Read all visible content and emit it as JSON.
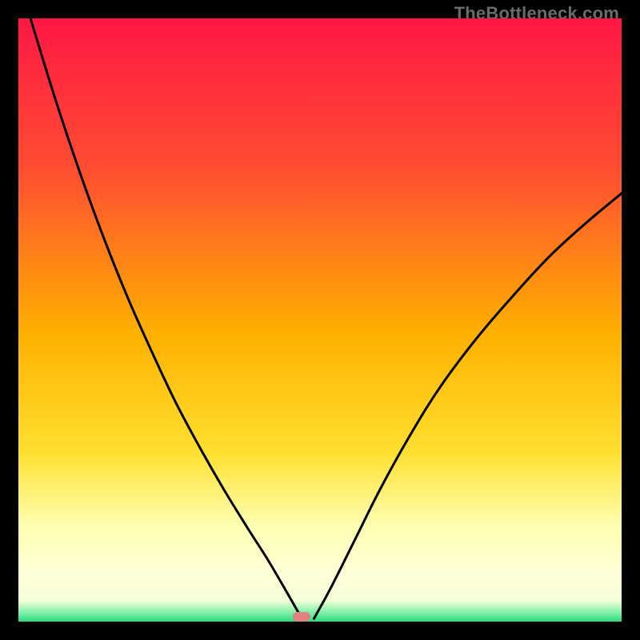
{
  "watermark": "TheBottleneck.com",
  "colors": {
    "bg": "#000000",
    "grad_top": "#ff1744",
    "grad_upper": "#ff5030",
    "grad_mid": "#ffb000",
    "grad_lowmid": "#ffe030",
    "grad_pale": "#ffffb0",
    "grad_green": "#2bd97c",
    "curve": "#000000",
    "marker": "#e08080"
  },
  "chart_data": {
    "type": "line",
    "title": "",
    "xlabel": "",
    "ylabel": "",
    "xlim": [
      0,
      100
    ],
    "ylim": [
      0,
      100
    ],
    "legend": false,
    "grid": false,
    "annotations": [],
    "minimum_x": 47,
    "left_curve": {
      "x": [
        2,
        6,
        10,
        14,
        18,
        22,
        26,
        30,
        34,
        38,
        41.5,
        45,
        47
      ],
      "y": [
        100,
        87,
        75,
        64,
        54,
        45,
        36.5,
        29,
        22,
        15.5,
        10,
        4,
        0.5
      ]
    },
    "right_curve": {
      "x": [
        49,
        52,
        56,
        60,
        65,
        70,
        76,
        82,
        88,
        94,
        100
      ],
      "y": [
        0.5,
        6,
        14,
        22,
        31,
        39,
        47,
        54,
        60.5,
        66,
        71
      ]
    }
  }
}
